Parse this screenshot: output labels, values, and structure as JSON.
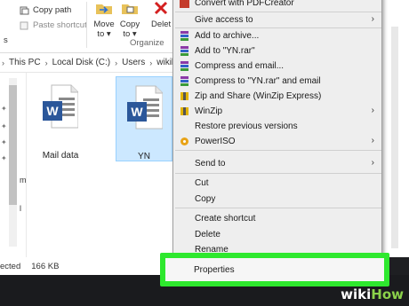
{
  "ribbon": {
    "copy_path": "Copy path",
    "paste_shortcut": "Paste shortcut",
    "clipboard_partial": "s",
    "move_to": "Move\nto",
    "copy_to": "Copy\nto",
    "delete_partial": "Delet",
    "organize_label": "Organize"
  },
  "address": {
    "crumbs": [
      "This PC",
      "Local Disk (C:)",
      "Users",
      "wikiho"
    ]
  },
  "nav": {
    "partial_items": [
      "mir",
      "l"
    ]
  },
  "files": [
    {
      "name": "Mail data",
      "selected": false
    },
    {
      "name": "YN",
      "selected": true
    }
  ],
  "status": {
    "selection": "ected",
    "size": "166 KB"
  },
  "context_menu": {
    "items": [
      {
        "label": "Convert with PDFCreator",
        "icon": "pdf-icon",
        "submenu": false
      },
      {
        "label": "Give access to",
        "icon": "",
        "submenu": true
      },
      {
        "label": "Add to archive...",
        "icon": "winrar-icon",
        "submenu": false
      },
      {
        "label": "Add to \"YN.rar\"",
        "icon": "winrar-icon",
        "submenu": false
      },
      {
        "label": "Compress and email...",
        "icon": "winrar-icon",
        "submenu": false
      },
      {
        "label": "Compress to \"YN.rar\" and email",
        "icon": "winrar-icon",
        "submenu": false
      },
      {
        "label": "Zip and Share (WinZip Express)",
        "icon": "winzip-icon",
        "submenu": false
      },
      {
        "label": "WinZip",
        "icon": "winzip-icon",
        "submenu": true
      },
      {
        "label": "Restore previous versions",
        "icon": "",
        "submenu": false
      },
      {
        "label": "PowerISO",
        "icon": "poweriso-icon",
        "submenu": true
      },
      {
        "label": "Send to",
        "icon": "",
        "submenu": true
      },
      {
        "label": "Cut",
        "icon": "",
        "submenu": false
      },
      {
        "label": "Copy",
        "icon": "",
        "submenu": false
      },
      {
        "label": "Create shortcut",
        "icon": "",
        "submenu": false
      },
      {
        "label": "Delete",
        "icon": "",
        "submenu": false
      },
      {
        "label": "Rename",
        "icon": "",
        "submenu": false
      },
      {
        "label": "Properties",
        "icon": "",
        "submenu": false
      }
    ]
  },
  "watermark": {
    "wiki": "wiki",
    "how": "How"
  },
  "colors": {
    "highlight": "#2ee82e",
    "word_blue": "#2b579a",
    "selection": "#cce8ff"
  }
}
